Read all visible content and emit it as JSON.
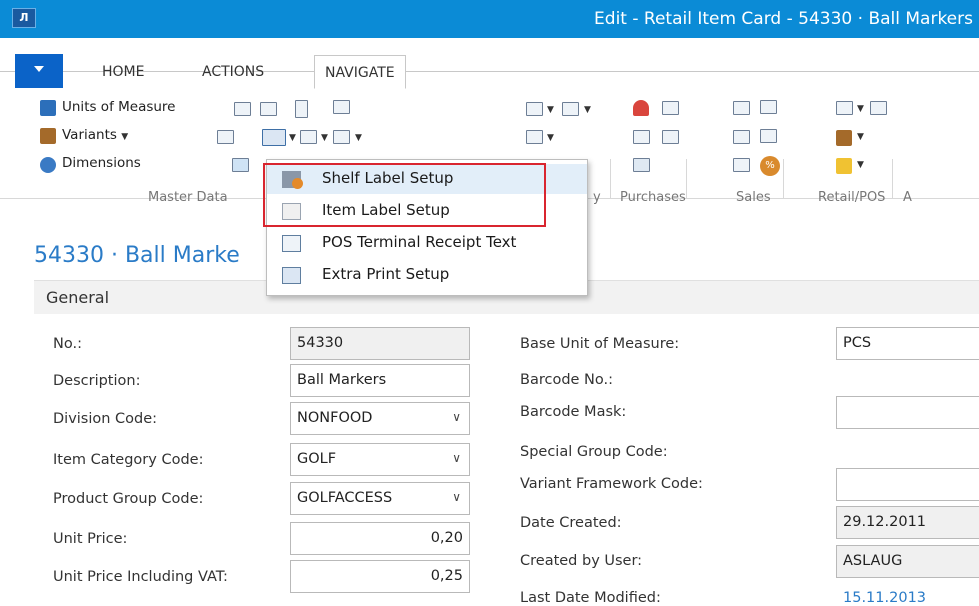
{
  "window": {
    "title": "Edit - Retail Item Card - 54330 · Ball Markers",
    "logo": "Л"
  },
  "tabs": [
    {
      "label": "HOME"
    },
    {
      "label": "ACTIONS"
    },
    {
      "label": "NAVIGATE"
    }
  ],
  "ribbon": {
    "master_data": {
      "units_of_measure": "Units of Measure",
      "variants": "Variants",
      "dimensions": "Dimensions",
      "group_label": "Master Data"
    },
    "group_labels": {
      "history": "y",
      "purchases": "Purchases",
      "sales": "Sales",
      "retail_pos": "Retail/POS",
      "next": "A"
    },
    "percent_badge": "%"
  },
  "dropdown": {
    "items": [
      {
        "label": "Shelf Label Setup",
        "icon": "shelf-label-icon"
      },
      {
        "label": "Item Label Setup",
        "icon": "item-label-icon"
      },
      {
        "label": "POS Terminal Receipt Text",
        "icon": "receipt-text-icon"
      },
      {
        "label": "Extra Print Setup",
        "icon": "printer-icon"
      }
    ]
  },
  "page": {
    "title": "54330 · Ball Marke",
    "section": "General"
  },
  "left_fields": [
    {
      "label": "No.:",
      "value": "54330"
    },
    {
      "label": "Description:",
      "value": "Ball Markers"
    },
    {
      "label": "Division Code:",
      "value": "NONFOOD"
    },
    {
      "label": "Item Category Code:",
      "value": "GOLF"
    },
    {
      "label": "Product Group Code:",
      "value": "GOLFACCESS"
    },
    {
      "label": "Unit Price:",
      "value": "0,20"
    },
    {
      "label": "Unit Price Including VAT:",
      "value": "0,25"
    }
  ],
  "right_fields": [
    {
      "label": "Base Unit of Measure:",
      "value": "PCS"
    },
    {
      "label": "Barcode No.:",
      "value": ""
    },
    {
      "label": "Barcode Mask:",
      "value": ""
    },
    {
      "label": "Special Group Code:",
      "value": ""
    },
    {
      "label": "Variant Framework Code:",
      "value": ""
    },
    {
      "label": "Date Created:",
      "value": "29.12.2011"
    },
    {
      "label": "Created by User:",
      "value": "ASLAUG"
    },
    {
      "label": "Last Date Modified:",
      "value": "15.11.2013"
    }
  ],
  "colors": {
    "titlebar": "#0b8bd6",
    "accent_link": "#2a7bc7",
    "highlight_border": "#d9252f",
    "menu_button": "#0b63c8"
  }
}
